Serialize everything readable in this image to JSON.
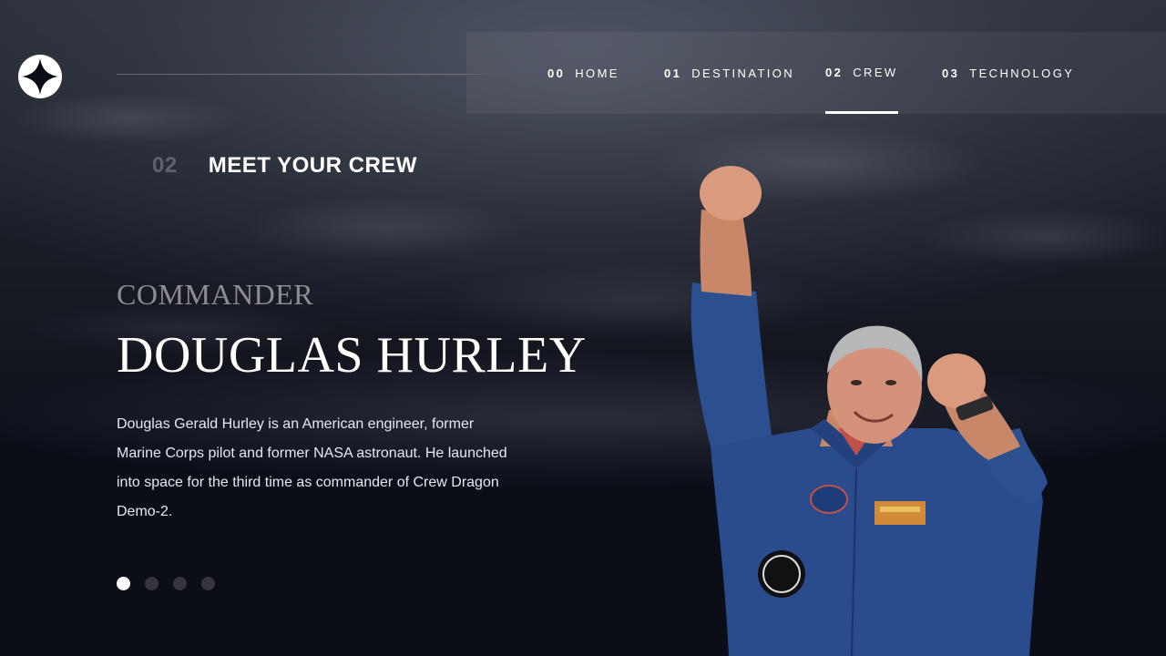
{
  "nav": {
    "items": [
      {
        "num": "00",
        "label": "HOME"
      },
      {
        "num": "01",
        "label": "DESTINATION"
      },
      {
        "num": "02",
        "label": "CREW"
      },
      {
        "num": "03",
        "label": "TECHNOLOGY"
      }
    ],
    "active_index": 2
  },
  "section": {
    "number": "02",
    "title": "MEET YOUR CREW"
  },
  "crew": {
    "role": "COMMANDER",
    "name": "DOUGLAS HURLEY",
    "bio": "Douglas Gerald Hurley is an American engineer, former Marine Corps pilot and former NASA astronaut. He launched into space for the third time as commander of Crew Dragon Demo-2.",
    "image": "astronaut-douglas-hurley-photo"
  },
  "carousel": {
    "count": 4,
    "active_index": 0
  },
  "colors": {
    "background": "#0b0d17",
    "text": "#ffffff",
    "muted": "rgba(255,255,255,0.5)"
  },
  "icons": {
    "logo": "star-logo-icon"
  }
}
